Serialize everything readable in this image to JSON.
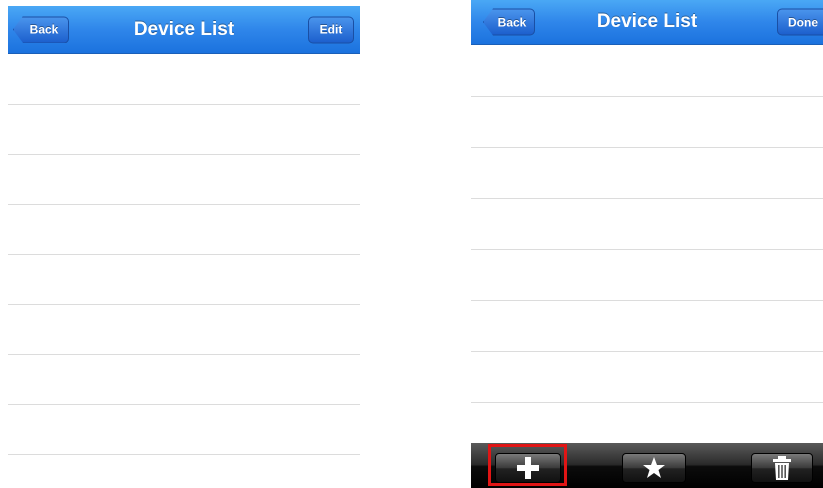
{
  "left_screen": {
    "navbar": {
      "title": "Device List",
      "back_label": "Back",
      "edit_label": "Edit"
    },
    "row_count": 8
  },
  "right_screen": {
    "navbar": {
      "title": "Device List",
      "back_label": "Back",
      "done_label": "Done"
    },
    "row_count": 8,
    "toolbar": {
      "items": [
        "plus-icon",
        "star-icon",
        "trash-icon"
      ],
      "highlighted_item": "plus-icon"
    }
  },
  "colors": {
    "navbar_blue": "#2f86ea",
    "highlight_red": "#e01515",
    "toolbar_black": "#000000"
  }
}
